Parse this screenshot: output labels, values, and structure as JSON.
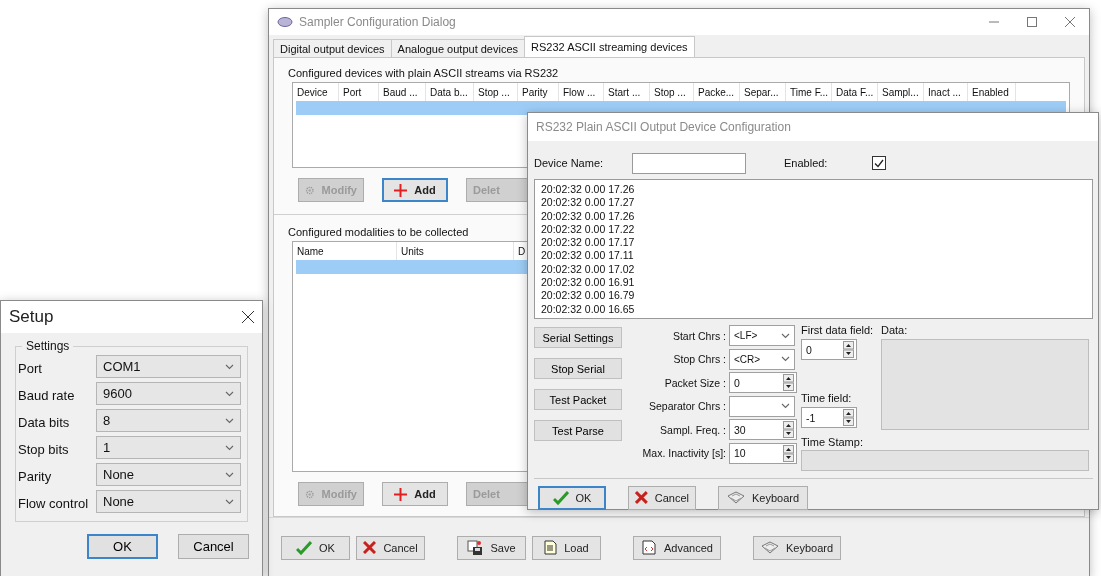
{
  "main_window": {
    "title": "Sampler Configuration Dialog",
    "tabs": [
      {
        "label": "Digital output devices",
        "selected": false
      },
      {
        "label": "Analogue output devices",
        "selected": false
      },
      {
        "label": "RS232 ASCII streaming devices",
        "selected": true
      }
    ],
    "devices": {
      "label": "Configured devices with plain ASCII streams via RS232",
      "columns": [
        "Device",
        "Port",
        "Baud ...",
        "Data b...",
        "Stop ...",
        "Parity",
        "Flow ...",
        "Start ...",
        "Stop ...",
        "Packe...",
        "Separ...",
        "Time F...",
        "Data F...",
        "Sampl...",
        "Inact ...",
        "Enabled"
      ],
      "rows": [
        {
          "selected": true
        }
      ],
      "buttons": [
        {
          "kind": "modify",
          "label": "Modify",
          "disabled": true,
          "focused": false
        },
        {
          "kind": "add",
          "label": "Add",
          "disabled": false,
          "focused": true
        },
        {
          "kind": "delete",
          "label": "Delet",
          "disabled": true,
          "focused": false
        }
      ]
    },
    "modalities": {
      "label": "Configured modalities to be collected",
      "columns": [
        "Name",
        "Units",
        "D"
      ],
      "rows": [
        {
          "selected": true
        }
      ],
      "buttons": [
        {
          "kind": "modify",
          "label": "Modify",
          "disabled": true,
          "focused": false
        },
        {
          "kind": "add",
          "label": "Add",
          "disabled": false,
          "focused": false
        },
        {
          "kind": "delete",
          "label": "Delet",
          "disabled": true,
          "focused": false
        }
      ]
    },
    "footer_groups": [
      [
        {
          "kind": "ok",
          "label": "OK"
        },
        {
          "kind": "cancel",
          "label": "Cancel"
        }
      ],
      [
        {
          "kind": "save",
          "label": "Save"
        },
        {
          "kind": "load",
          "label": "Load"
        }
      ],
      [
        {
          "kind": "advanced",
          "label": "Advanced"
        }
      ],
      [
        {
          "kind": "keyboard",
          "label": "Keyboard"
        }
      ]
    ]
  },
  "device_dialog": {
    "title": "RS232 Plain ASCII Output Device Configuration",
    "device_name_label": "Device Name:",
    "enabled": {
      "label": "Enabled:",
      "checked": true
    },
    "log_lines": [
      "20:02:32 0.00 17.26",
      "20:02:32 0.00 17.27",
      "20:02:32 0.00 17.26",
      "20:02:32 0.00 17.22",
      "20:02:32 0.00 17.17",
      "20:02:32 0.00 17.11",
      "20:02:32 0.00 17.02",
      "20:02:32 0.00 16.91",
      "20:02:32 0.00 16.79",
      "20:02:32 0.00 16.65"
    ],
    "actions": [
      "Serial Settings",
      "Stop Serial",
      "Test Packet",
      "Test Parse"
    ],
    "fields": [
      {
        "kind": "dropdown",
        "label": "Start Chrs :",
        "value": "<LF>"
      },
      {
        "kind": "dropdown",
        "label": "Stop Chrs :",
        "value": "<CR>"
      },
      {
        "kind": "spinner",
        "label": "Packet Size :",
        "value": "0"
      },
      {
        "kind": "dropdown",
        "label": "Separator Chrs :"
      },
      {
        "kind": "spinner",
        "label": "Sampl. Freq. :",
        "value": "30"
      },
      {
        "kind": "spinner",
        "label": "Max. Inactivity [s]:",
        "value": "10"
      }
    ],
    "first_data_field": {
      "label": "First data field:",
      "value": "0"
    },
    "time_field": {
      "label": "Time field:",
      "value": "-1"
    },
    "data_label": "Data:",
    "time_stamp_label": "Time Stamp:",
    "buttons": [
      {
        "kind": "ok",
        "label": "OK",
        "focused": true
      },
      {
        "kind": "cancel",
        "label": "Cancel",
        "focused": false
      },
      {
        "kind": "keyboard",
        "label": "Keyboard",
        "focused": false
      }
    ]
  },
  "setup_dialog": {
    "title": "Setup",
    "group_label": "Settings",
    "rows": [
      {
        "label": "Port",
        "value": "COM1"
      },
      {
        "label": "Baud rate",
        "value": "9600"
      },
      {
        "label": "Data bits",
        "value": "8"
      },
      {
        "label": "Stop bits",
        "value": "1"
      },
      {
        "label": "Parity",
        "value": "None"
      },
      {
        "label": "Flow control",
        "value": "None"
      }
    ],
    "buttons": [
      {
        "label": "OK",
        "focused": true
      },
      {
        "label": "Cancel",
        "focused": false
      }
    ]
  }
}
